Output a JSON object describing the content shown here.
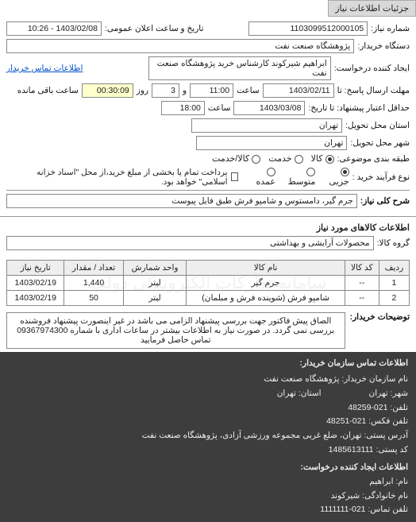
{
  "tab": {
    "title": "جزئیات اطلاعات نیاز"
  },
  "header": {
    "labels": {
      "req_no": "شماره نیاز:",
      "announce_dt": "تاریخ و ساعت اعلان عمومی:",
      "buyer_unit": "دستگاه خریدار:",
      "requester": "ایجاد کننده درخواست:",
      "deadline": "مهلت ارسال پاسخ: تا",
      "at_time": "ساعت",
      "and_days": "و",
      "days_unit": "روز",
      "remaining": "ساعت باقی مانده",
      "title_validity": "حداقل اعتبار پیشنهاد: تا تاریخ:",
      "delivery_province": "استان محل تحویل:",
      "delivery_city": "شهر محل تحویل:",
      "pack_class": "طبقه بندی موضوعی:",
      "purchase_type": "نوع فرآیند خرید :",
      "contact_link": "اطلاعات تماس خریدار"
    },
    "values": {
      "req_no": "1103099512000105",
      "announce_dt": "1403/02/08 - 10:26",
      "buyer_unit": "پژوهشگاه صنعت نفت",
      "requester": "ابراهیم شیرکوند کارشناس خرید پژوهشگاه صنعت نفت",
      "deadline_date": "1403/02/11",
      "deadline_time": "11:00",
      "days_left": "3",
      "time_left": "00:30:09",
      "validity_date": "1403/03/08",
      "validity_time": "18:00",
      "province": "تهران",
      "city": "تهران"
    },
    "radios": {
      "goods": "کالا",
      "service": "خدمت",
      "goods_service": "کالا/خدمت",
      "low": "جزیی",
      "medium": "متوسط",
      "high": "عمده"
    },
    "purchase_note": "پرداخت تمام یا بخشی از مبلغ خرید،از محل \"اسناد خزانه اسلامی\" خواهد بود.",
    "summary_label": "شرح کلی نیاز:",
    "summary_value": "جرم گیر، دامستوس و شامپو فرش طبق فایل پیوست"
  },
  "items_section": {
    "title": "اطلاعات کالاهای مورد نیاز",
    "group_label": "گروه کالا:",
    "group_value": "محصولات آرایشی و بهداشتی",
    "columns": {
      "row": "ردیف",
      "code": "کد کالا",
      "name": "نام کالا",
      "unit": "واحد شمارش",
      "qty": "تعداد / مقدار",
      "date": "تاریخ نیاز"
    },
    "rows": [
      {
        "idx": "1",
        "code": "--",
        "name": "جرم گیر",
        "unit": "لیتر",
        "qty": "1,440",
        "date": "1403/02/19"
      },
      {
        "idx": "2",
        "code": "--",
        "name": "شامپو فرش (شوینده فرش و مبلمان)",
        "unit": "لیتر",
        "qty": "50",
        "date": "1403/02/19"
      }
    ],
    "watermark": "سامانه تدارکات الکترونیکی دولت"
  },
  "buyer_notes": {
    "label": "توضیحات خریدار:",
    "text": "الصاق پیش فاکتور جهت بررسی پیشنهاد الزامی می باشد در غیر اینصورت پیشنهاد فروشنده بررسی نمی گردد. در صورت نیاز به اطلاعات بیشتر در ساعات اداری با شماره 09367974300 تماس حاصل فرمایید"
  },
  "contact_block": {
    "title": "اطلاعات تماس سازمان خریدار:",
    "labels": {
      "org": "نام سازمان خریدار:",
      "city": "شهر:",
      "phone1": "تلفن:",
      "fax": "تلفن فکس:",
      "addr": "آدرس پستی:",
      "pobox": "کد پستی:",
      "req_title2": "اطلاعات ایجاد کننده درخواست:",
      "first": "نام:",
      "last": "نام خانوادگی:",
      "phone2": "تلفن تماس:",
      "province": "استان:"
    },
    "values": {
      "org": "پژوهشگاه صنعت نفت",
      "city": "تهران",
      "province": "تهران",
      "phone1": "021-48259",
      "fax": "021-48251",
      "addr": "تهران، ضلع غربی مجموعه ورزشی آزادی، پژوهشگاه صنعت نفت",
      "pobox": "1485613111",
      "first": "ابراهیم",
      "last": "شیرکوند",
      "phone2": "021-1111111"
    }
  }
}
